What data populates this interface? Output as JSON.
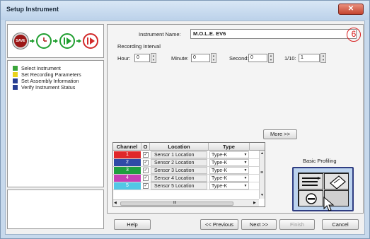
{
  "window": {
    "title": "Setup Instrument",
    "close_label": "✕"
  },
  "workflow": {
    "icons": [
      "save-icon",
      "clock-icon",
      "play-record-icon",
      "record-end-icon"
    ],
    "first_step_label": "SAVE"
  },
  "steps": [
    {
      "label": "Select Instrument",
      "color": "#3aa53a"
    },
    {
      "label": "Set Recording Parameters",
      "color": "#e8d21d"
    },
    {
      "label": "Set Assembly Information",
      "color": "#283e92"
    },
    {
      "label": "Verify Instrument Status",
      "color": "#283e92"
    }
  ],
  "form": {
    "instrument_name_label": "Instrument Name:",
    "instrument_name_value": "M.O.L.E. EV6",
    "badge": "6",
    "recording_interval_label": "Recording Interval",
    "hour_label": "Hour:",
    "hour_value": "0",
    "minute_label": "Minute:",
    "minute_value": "0",
    "second_label": "Second:",
    "second_value": "0",
    "tenth_label": "1/10:",
    "tenth_value": "1",
    "more_label": "More >>"
  },
  "grid": {
    "headers": [
      "Channel",
      "O",
      "Location",
      "Type"
    ],
    "rows": [
      {
        "channel": "1",
        "color": "#e0282a",
        "checked": "✓",
        "location": "Sensor 1 Location",
        "type": "Type-K"
      },
      {
        "channel": "2",
        "color": "#2f4aa6",
        "checked": "✓",
        "location": "Sensor 2 Location",
        "type": "Type-K"
      },
      {
        "channel": "3",
        "color": "#1f9e3f",
        "checked": "✓",
        "location": "Sensor 3 Location",
        "type": "Type-K"
      },
      {
        "channel": "4",
        "color": "#c640b5",
        "checked": "✓",
        "location": "Sensor 4 Location",
        "type": "Type-K"
      },
      {
        "channel": "5",
        "color": "#52c7e6",
        "checked": "✓",
        "location": "Sensor 5 Location",
        "type": "Type-K"
      }
    ],
    "type_arrow": "▼",
    "scroll_up": "▲",
    "scroll_down": "▼",
    "scroll_mid": "≡",
    "scroll_left": "◀",
    "scroll_right": "▶",
    "hthumb_grip": "III"
  },
  "profiling": {
    "title": "Basic Profiling"
  },
  "buttons": {
    "help": "Help",
    "previous": "<< Previous",
    "next": "Next >>",
    "finish": "Finish",
    "cancel": "Cancel"
  }
}
